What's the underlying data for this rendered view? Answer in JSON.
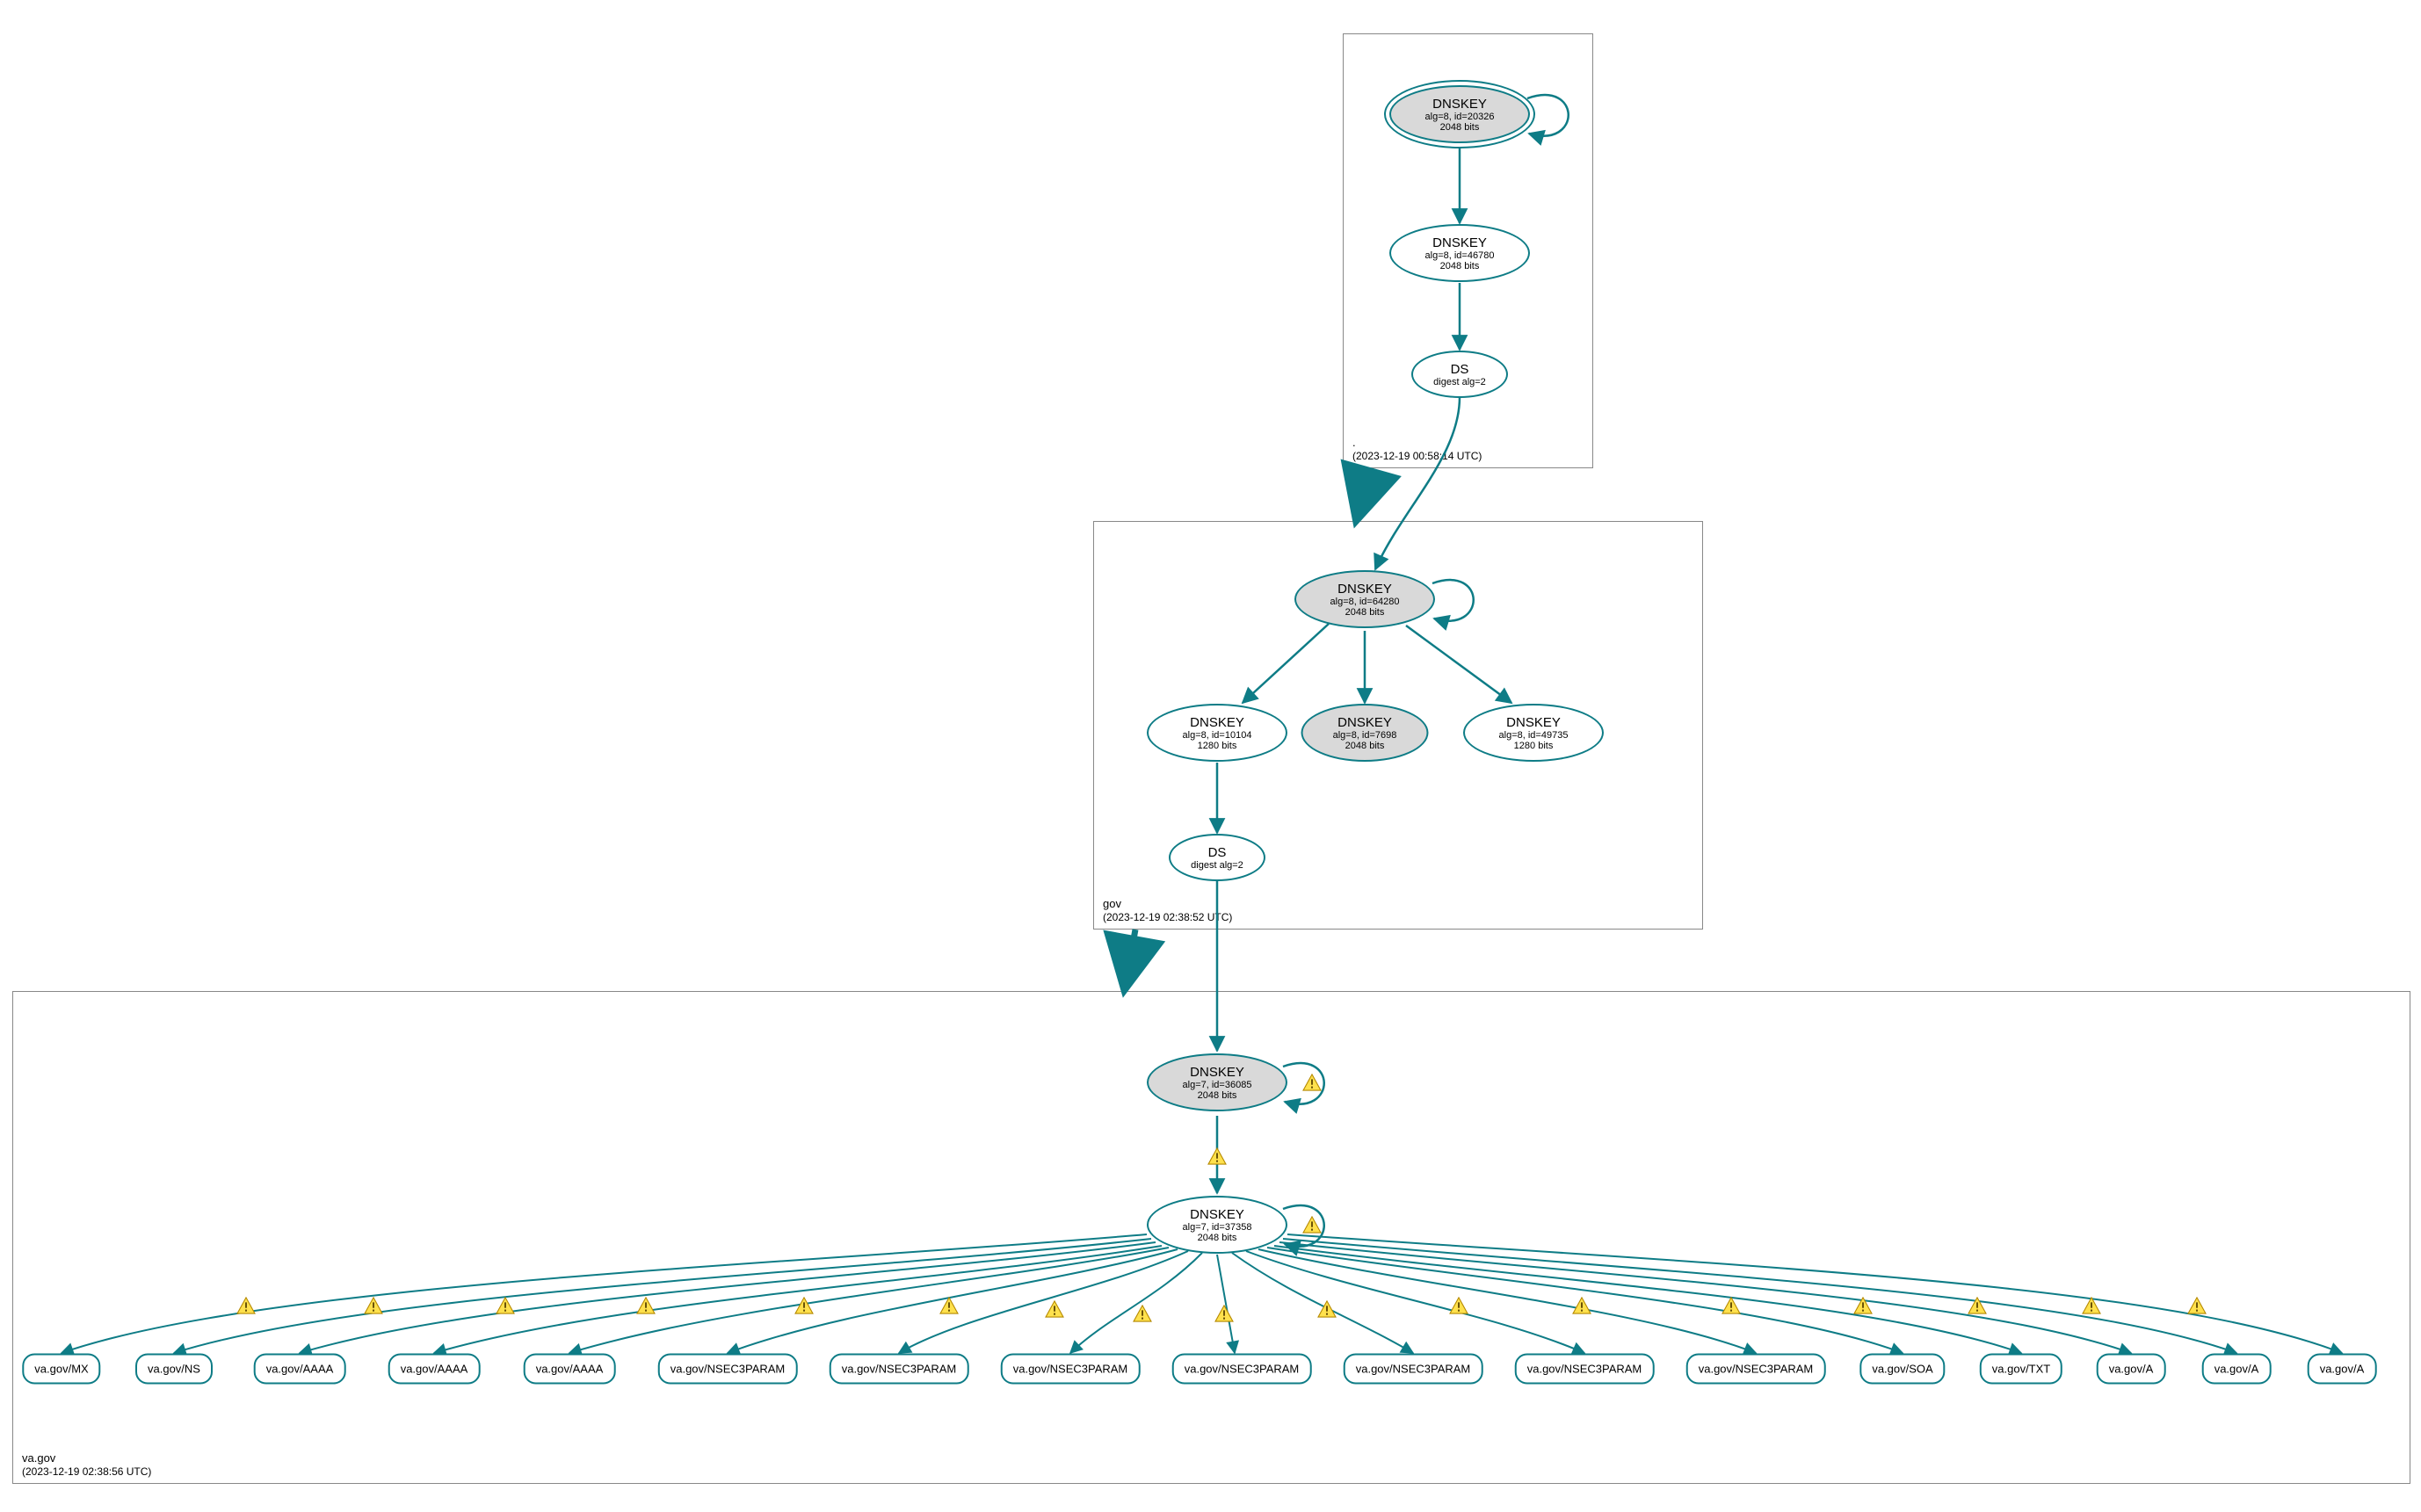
{
  "colors": {
    "stroke": "#0e7c86",
    "zone_border": "#888888"
  },
  "zones": {
    "root": {
      "name": ".",
      "timestamp": "(2023-12-19 00:58:14 UTC)"
    },
    "gov": {
      "name": "gov",
      "timestamp": "(2023-12-19 02:38:52 UTC)"
    },
    "vagov": {
      "name": "va.gov",
      "timestamp": "(2023-12-19 02:38:56 UTC)"
    }
  },
  "nodes": {
    "root_ksk": {
      "title": "DNSKEY",
      "sub1": "alg=8, id=20326",
      "sub2": "2048 bits"
    },
    "root_zsk": {
      "title": "DNSKEY",
      "sub1": "alg=8, id=46780",
      "sub2": "2048 bits"
    },
    "root_ds": {
      "title": "DS",
      "sub1": "digest alg=2"
    },
    "gov_ksk": {
      "title": "DNSKEY",
      "sub1": "alg=8, id=64280",
      "sub2": "2048 bits"
    },
    "gov_zsk_l": {
      "title": "DNSKEY",
      "sub1": "alg=8, id=10104",
      "sub2": "1280 bits"
    },
    "gov_k_mid": {
      "title": "DNSKEY",
      "sub1": "alg=8, id=7698",
      "sub2": "2048 bits"
    },
    "gov_zsk_r": {
      "title": "DNSKEY",
      "sub1": "alg=8, id=49735",
      "sub2": "1280 bits"
    },
    "gov_ds": {
      "title": "DS",
      "sub1": "digest alg=2"
    },
    "va_ksk": {
      "title": "DNSKEY",
      "sub1": "alg=7, id=36085",
      "sub2": "2048 bits"
    },
    "va_zsk": {
      "title": "DNSKEY",
      "sub1": "alg=7, id=37358",
      "sub2": "2048 bits"
    }
  },
  "rrsets": [
    "va.gov/MX",
    "va.gov/NS",
    "va.gov/AAAA",
    "va.gov/AAAA",
    "va.gov/AAAA",
    "va.gov/NSEC3PARAM",
    "va.gov/NSEC3PARAM",
    "va.gov/NSEC3PARAM",
    "va.gov/NSEC3PARAM",
    "va.gov/NSEC3PARAM",
    "va.gov/NSEC3PARAM",
    "va.gov/NSEC3PARAM",
    "va.gov/SOA",
    "va.gov/TXT",
    "va.gov/A",
    "va.gov/A",
    "va.gov/A"
  ]
}
